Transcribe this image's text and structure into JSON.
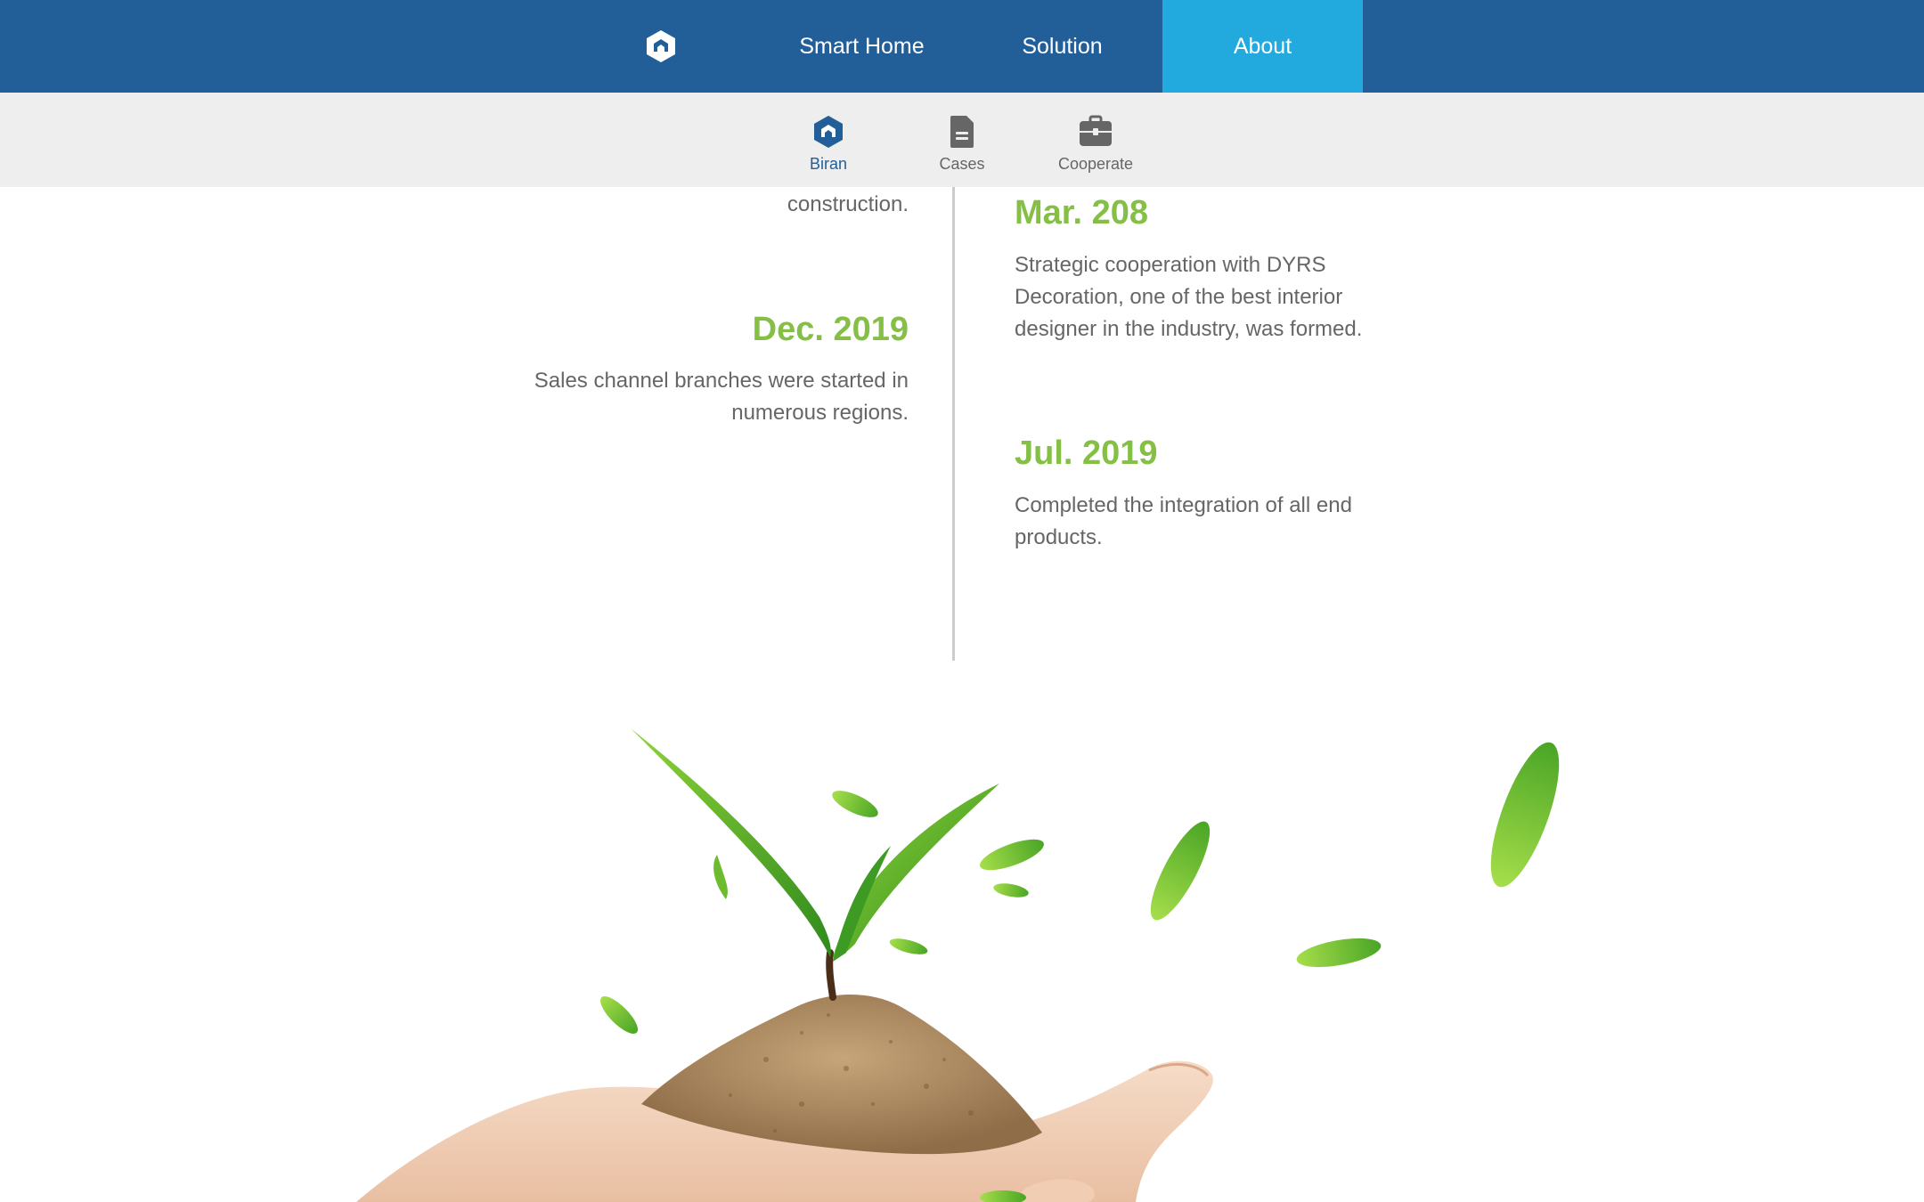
{
  "topnav": {
    "logo_icon": "biran-logo-icon",
    "items": [
      {
        "label": "Smart Home",
        "active": false
      },
      {
        "label": "Solution",
        "active": false
      },
      {
        "label": "About",
        "active": true
      }
    ]
  },
  "subnav": {
    "items": [
      {
        "label": "Biran",
        "icon": "biran-logo-icon",
        "active": true
      },
      {
        "label": "Cases",
        "icon": "document-icon",
        "active": false
      },
      {
        "label": "Cooperate",
        "icon": "briefcase-icon",
        "active": false
      }
    ]
  },
  "timeline": {
    "left": [
      {
        "date": "",
        "text": "construction."
      },
      {
        "date": "Dec. 2019",
        "text": "Sales channel branches were started in numerous regions."
      }
    ],
    "right": [
      {
        "date": "Mar. 208",
        "text": "Strategic cooperation with DYRS Decoration, one of the best interior designer in the industry, was formed."
      },
      {
        "date": "Jul. 2019",
        "text": "Completed the integration of all end products."
      }
    ]
  },
  "colors": {
    "nav_bg": "#225f98",
    "nav_active": "#22aadf",
    "subnav_bg": "#eeeeee",
    "date_green": "#85bf45",
    "body_text": "#666666"
  }
}
